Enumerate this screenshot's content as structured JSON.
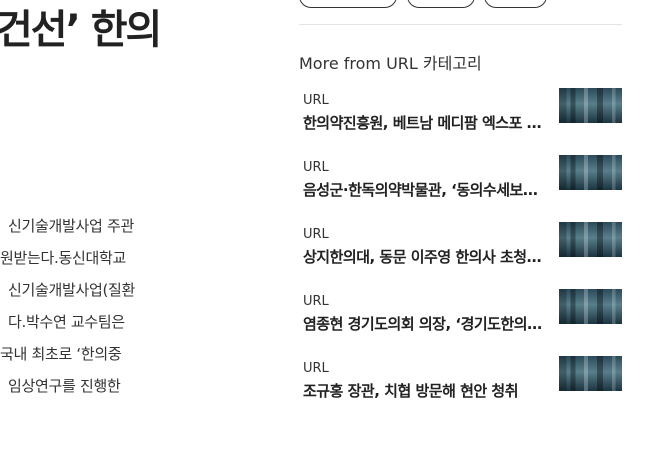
{
  "article": {
    "title": "건선’ 한의",
    "body_lines": [
      "신기술개발사업 주관",
      "원받는다.동신대학교",
      "신기술개발사업(질환",
      "다.박수연 교수팀은",
      "국내 최초로 ‘한의중",
      "임상연구를 진행한"
    ]
  },
  "sidebar": {
    "heading": "More from URL 카테고리",
    "items": [
      {
        "source": "URL",
        "title": "한의약진흥원, 베트남 메디팜 엑스포 참가"
      },
      {
        "source": "URL",
        "title": "음성군·한독의약박물관, ‘동의수세보원’ 전시"
      },
      {
        "source": "URL",
        "title": "상지한의대, 동문 이주영 한의사 초청 특강"
      },
      {
        "source": "URL",
        "title": "염종현 경기도의회 의장, ‘경기도한의사회’ 방문"
      },
      {
        "source": "URL",
        "title": "조규홍 장관, 치협 방문해 현안 청취"
      }
    ]
  }
}
